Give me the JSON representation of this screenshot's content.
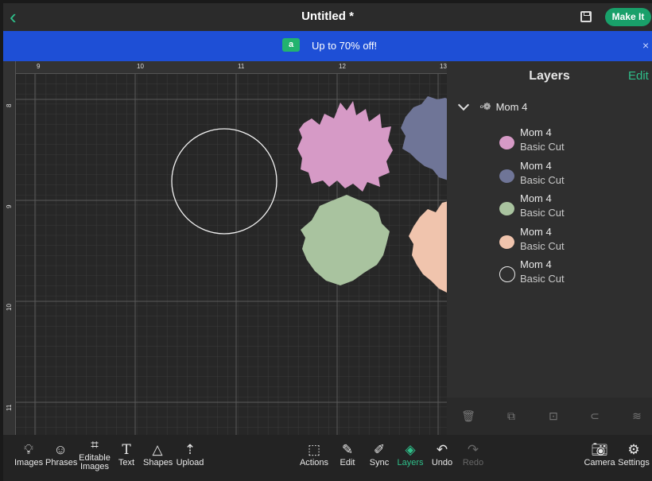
{
  "topbar": {
    "back_icon": "chevron-left-icon",
    "title": "Untitled *",
    "save_icon": "save-icon",
    "make_it_label": "Make It"
  },
  "promo": {
    "icon": "tag-icon",
    "text": "Up to 70% off!",
    "close": "×"
  },
  "canvas": {
    "ruler_top": [
      "9",
      "10",
      "11",
      "12",
      "13"
    ],
    "ruler_left": [
      "8",
      "9",
      "10",
      "11"
    ],
    "shapes": [
      {
        "name": "circle-outline",
        "color": "#ffffff"
      },
      {
        "name": "pink-burst",
        "color": "#d69ac6"
      },
      {
        "name": "blue-burst",
        "color": "#6f7597"
      },
      {
        "name": "green-burst",
        "color": "#a9c39f"
      },
      {
        "name": "peach-burst",
        "color": "#f0c4ad"
      }
    ]
  },
  "layers_panel": {
    "title": "Layers",
    "edit_label": "Edit",
    "group_name": "Mom 4",
    "layers": [
      {
        "name": "Mom 4",
        "type": "Basic Cut",
        "color": "#d69ac6"
      },
      {
        "name": "Mom 4",
        "type": "Basic Cut",
        "color": "#6f7597"
      },
      {
        "name": "Mom 4",
        "type": "Basic Cut",
        "color": "#a9c39f"
      },
      {
        "name": "Mom 4",
        "type": "Basic Cut",
        "color": "#f0c4ad"
      },
      {
        "name": "Mom 4",
        "type": "Basic Cut",
        "color": "outline"
      }
    ],
    "tools": [
      "trash-icon",
      "duplicate-icon",
      "hide-icon",
      "attach-icon",
      "arrange-icon"
    ]
  },
  "bottombar": {
    "images": "Images",
    "phrases": "Phrases",
    "editable_images_1": "Editable",
    "editable_images_2": "Images",
    "text": "Text",
    "shapes": "Shapes",
    "upload": "Upload",
    "actions": "Actions",
    "edit": "Edit",
    "sync": "Sync",
    "layers": "Layers",
    "undo": "Undo",
    "redo": "Redo",
    "camera": "Camera",
    "settings": "Settings"
  },
  "colors": {
    "accent": "#2fbf8a",
    "promo": "#1e4fd6",
    "canvas": "#272727",
    "panel": "#2f2f2f"
  }
}
